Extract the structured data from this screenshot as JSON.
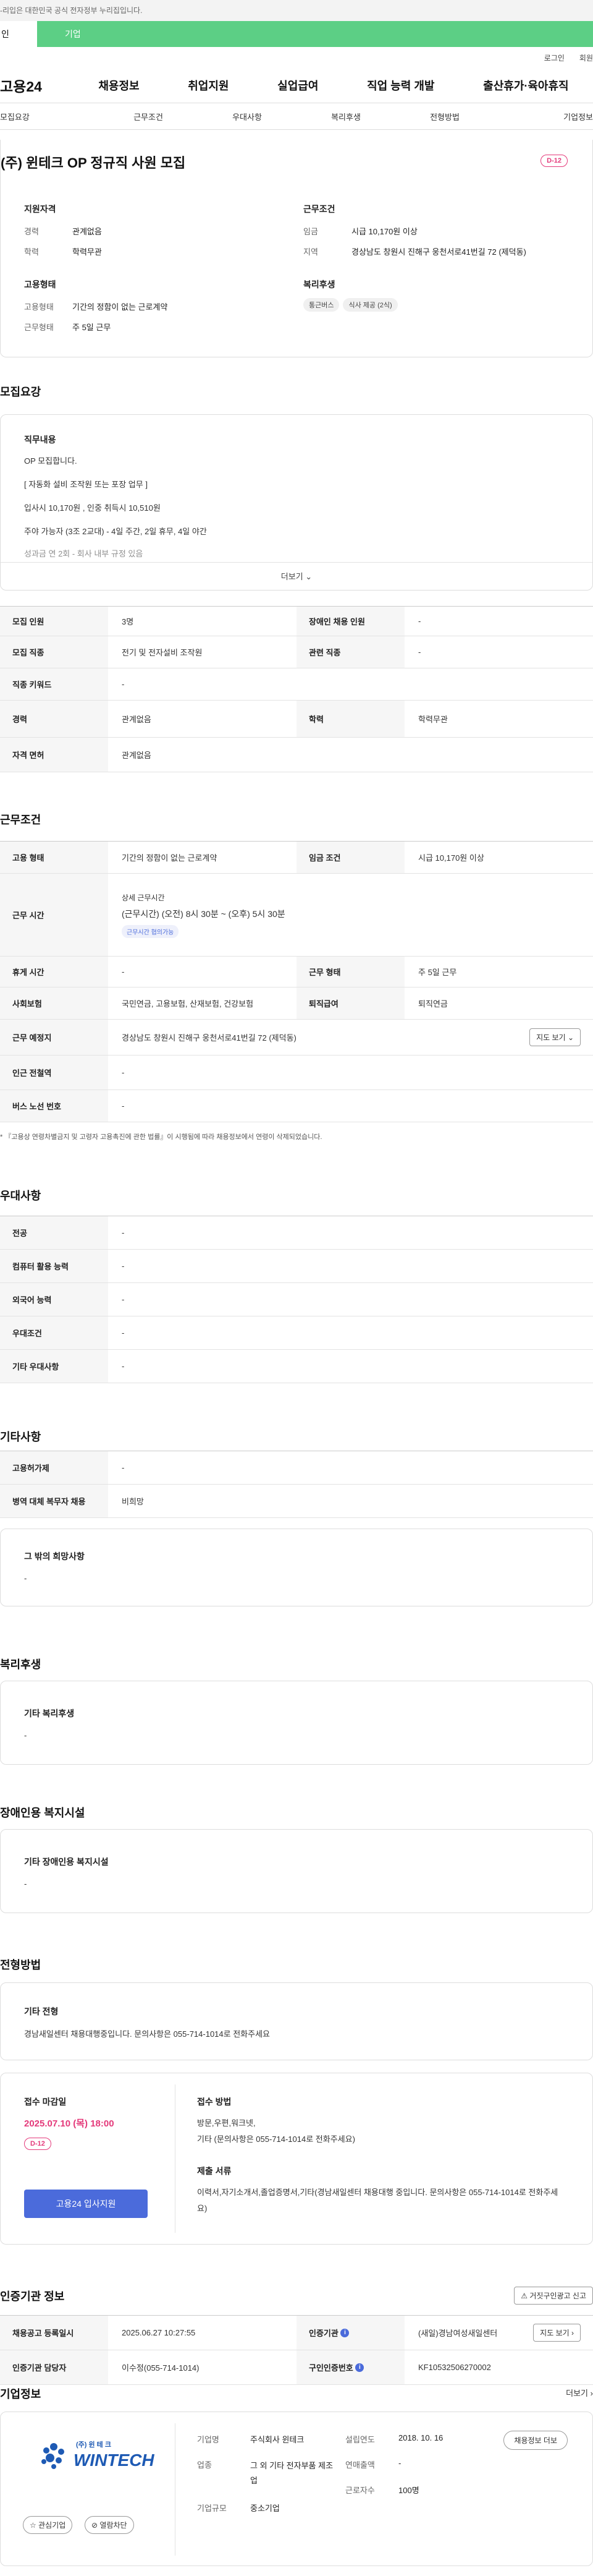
{
  "banner": {
    "text": "-리입은 대한민국 공식 전자정부 누리집입니다."
  },
  "scope": {
    "individual": "인",
    "enterprise": "기업"
  },
  "util": {
    "login": "로그인",
    "join": "회원"
  },
  "gnb": {
    "logo": "고용24",
    "menu": [
      "채용정보",
      "취업지원",
      "실업급여",
      "직업 능력 개발",
      "출산휴가·육아휴직"
    ]
  },
  "tabs": [
    "모집요강",
    "근무조건",
    "우대사항",
    "복리후생",
    "전형방법",
    "기업정보"
  ],
  "job": {
    "title": "(주) 윈테크 OP 정규직 사원 모집",
    "dday": "D-12",
    "qual_title": "지원자격",
    "qual": [
      {
        "label": "경력",
        "value": "관계없음"
      },
      {
        "label": "학력",
        "value": "학력무관"
      }
    ],
    "cond_title": "근무조건",
    "cond": [
      {
        "label": "임금",
        "value": "시급 10,170원 이상"
      },
      {
        "label": "지역",
        "value": "경상남도 창원시 진해구 웅천서로41번길 72 (제덕동)"
      }
    ],
    "emp_title": "고용형태",
    "emp": [
      {
        "label": "고용형태",
        "value": "기간의 정함이 없는 근로계약"
      },
      {
        "label": "근무형태",
        "value": "주 5일 근무"
      }
    ],
    "welfare_title": "복리후생",
    "welfare_tags": [
      "통근버스",
      "식사 제공 (2식)"
    ]
  },
  "recruit": {
    "title": "모집요강",
    "duty_title": "직무내용",
    "duty_lines": [
      "OP 모집합니다.",
      "[ 자동화 설비 조작원 또는 포장 업무 ]",
      "입사시 10,170원 , 인중 취득시 10,510원",
      "주야 가능자 (3조 2교대) - 4일 주간, 2일 휴무, 4일 야간",
      "성과금 연 2회 - 회사 내부 규정 있음"
    ],
    "more": "더보기",
    "rows": [
      [
        {
          "th": "모집 인원",
          "td": "3명"
        },
        {
          "th": "장애인 채용 인원",
          "td": "-"
        }
      ],
      [
        {
          "th": "모집 직종",
          "td": "전기 및 전자설비 조작원"
        },
        {
          "th": "관련 직종",
          "td": "-"
        }
      ],
      [
        {
          "th": "직종 키워드",
          "td": "-"
        }
      ],
      [
        {
          "th": "경력",
          "td": "관계없음"
        },
        {
          "th": "학력",
          "td": "학력무관"
        }
      ],
      [
        {
          "th": "자격 면허",
          "td": "관계없음"
        }
      ]
    ]
  },
  "work": {
    "title": "근무조건",
    "emp_type_th": "고용 형태",
    "emp_type_td": "기간의 정함이 없는 근로계약",
    "wage_th": "임금 조건",
    "wage_td": "시급 10,170원 이상",
    "hours_th": "근무 시간",
    "hours_sub": "상세 근무시간",
    "hours_td": "(근무시간) (오전) 8시 30분 ~ (오후) 5시 30분",
    "hours_tag": "근무시간 협의가능",
    "rest_th": "휴게 시간",
    "rest_td": "-",
    "shape_th": "근무 형태",
    "shape_td": "주 5일 근무",
    "ins_th": "사회보험",
    "ins_td": "국민연금, 고용보험, 산재보험, 건강보험",
    "ret_th": "퇴직급여",
    "ret_td": "퇴직연금",
    "place_th": "근무 예정지",
    "place_td": "경상남도 창원시 진해구 웅천서로41번길 72 (제덕동)",
    "map_btn": "지도 보기",
    "station_th": "인근 전철역",
    "station_td": "-",
    "bus_th": "버스 노선 번호",
    "bus_td": "-",
    "note": "* 『고용상 연령차별금지 및 고령자 고용촉진에 관한 법률』이 시행됨에 따라 채용정보에서 연령이 삭제되었습니다."
  },
  "pref": {
    "title": "우대사항",
    "rows": [
      {
        "th": "전공",
        "td": "-"
      },
      {
        "th": "컴퓨터 활용 능력",
        "td": "-"
      },
      {
        "th": "외국어 능력",
        "td": "-"
      },
      {
        "th": "우대조건",
        "td": "-"
      },
      {
        "th": "기타 우대사항",
        "td": "-"
      }
    ]
  },
  "etc": {
    "title": "기타사항",
    "rows": [
      {
        "th": "고용허가제",
        "td": "-"
      },
      {
        "th": "병역 대체 복무자 채용",
        "td": "비희망"
      }
    ],
    "other_title": "그 밖의 희망사항",
    "other_val": "-"
  },
  "welfare": {
    "title": "복리후생",
    "card_title": "기타 복리후생",
    "card_val": "-"
  },
  "disabled": {
    "title": "장애인용 복지시설",
    "card_title": "기타 장애인용 복지시설",
    "card_val": "-"
  },
  "selection": {
    "title": "전형방법",
    "card_title": "기타 전형",
    "card_val": "경남새일센터 채용대행중입니다. 문의사항은 055-714-1014로 전화주세요",
    "deadline_title": "접수 마감일",
    "deadline_val": "2025.07.10 (목) 18:00",
    "dday": "D-12",
    "apply_btn": "고용24 입사지원",
    "method_title": "접수 방법",
    "method_val": "방문,우편,워크넷,\n기타 (문의사항은 055-714-1014로 전화주세요)",
    "docs_title": "제출 서류",
    "docs_val": "이력서,자기소개서,졸업증명서,기타(경남새일센터 채용대행 중입니다. 문의사항은 055-714-1014로 전화주세요)"
  },
  "agency": {
    "title": "인증기관 정보",
    "report_btn": "거짓구인광고 신고",
    "r1_th1": "채용공고 등록일시",
    "r1_td1": "2025.06.27 10:27:55",
    "r1_th2": "인증기관",
    "r1_td2": "(새일)경남여성새일센터",
    "r1_btn": "지도 보기",
    "r2_th1": "인증기관 담당자",
    "r2_td1": "이수정(055-714-1014)",
    "r2_th2": "구인인증번호",
    "r2_td2": "KF10532506270002"
  },
  "company": {
    "title": "기업정보",
    "more": "더보기",
    "logo_text": "(주) 윈 테 크",
    "logo_brand": "WINTECH",
    "fav_btn": "관심기업",
    "follow_btn": "열람차단",
    "col1": [
      {
        "label": "기업명",
        "value": "주식회사 윈테크"
      },
      {
        "label": "업종",
        "value": "그 외 기타 전자부품 제조업"
      },
      {
        "label": "기업규모",
        "value": "중소기업"
      }
    ],
    "col2": [
      {
        "label": "설립연도",
        "value": "2018. 10. 16"
      },
      {
        "label": "연매출액",
        "value": "-"
      },
      {
        "label": "근로자수",
        "value": "100명"
      }
    ],
    "info_btn": "채용정보 더보"
  },
  "colors": {
    "accent": "#4b6bdb",
    "danger": "#e4397a",
    "green": "#5ccf85"
  }
}
